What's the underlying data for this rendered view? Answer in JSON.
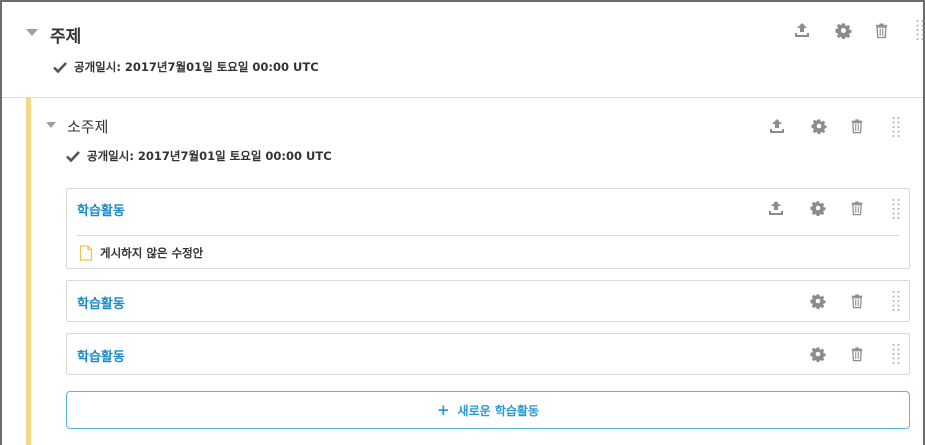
{
  "section": {
    "title": "주제",
    "release": "공개일시: 2017년7월01일 토요일 00:00 UTC"
  },
  "subsection": {
    "title": "소주제",
    "release": "공개일시: 2017년7월01일 토요일 00:00 UTC"
  },
  "activities": [
    {
      "title": "학습활동",
      "note": "게시하지 않은 수정안"
    },
    {
      "title": "학습활동"
    },
    {
      "title": "학습활동"
    }
  ],
  "add_button": {
    "label": "새로운 학습활동",
    "icon": "plus-icon"
  },
  "icons": {
    "publish": "upload-icon",
    "settings": "gear-icon",
    "delete": "trash-icon",
    "drag": "drag-handle-icon",
    "collapse": "caret-down-icon",
    "released": "check-icon",
    "draft": "document-icon"
  },
  "colors": {
    "link": "#1a8bc9",
    "subsection_rail": "#f5d682",
    "add_button_border": "#5bb7dd",
    "icon_gray": "#8c8c8c"
  }
}
